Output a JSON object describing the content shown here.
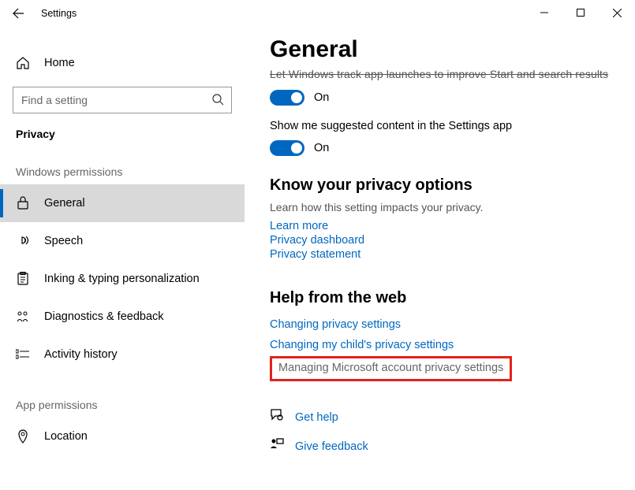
{
  "window": {
    "title": "Settings"
  },
  "sidebar": {
    "home": "Home",
    "search_placeholder": "Find a setting",
    "current_section": "Privacy",
    "group1_header": "Windows permissions",
    "group1": [
      {
        "label": "General"
      },
      {
        "label": "Speech"
      },
      {
        "label": "Inking & typing personalization"
      },
      {
        "label": "Diagnostics & feedback"
      },
      {
        "label": "Activity history"
      }
    ],
    "group2_header": "App permissions",
    "group2": [
      {
        "label": "Location"
      }
    ]
  },
  "main": {
    "title": "General",
    "cutoff_text": "Let Windows track app launches to improve Start and search results",
    "toggle1_state": "On",
    "setting2_label": "Show me suggested content in the Settings app",
    "toggle2_state": "On",
    "privacy_head": "Know your privacy options",
    "privacy_desc": "Learn how this setting impacts your privacy.",
    "privacy_links": [
      "Learn more",
      "Privacy dashboard",
      "Privacy statement"
    ],
    "help_head": "Help from the web",
    "help_links": [
      "Changing privacy settings",
      "Changing my child's privacy settings"
    ],
    "highlighted_link": "Managing Microsoft account privacy settings",
    "footer": {
      "get_help": "Get help",
      "give_feedback": "Give feedback"
    }
  }
}
